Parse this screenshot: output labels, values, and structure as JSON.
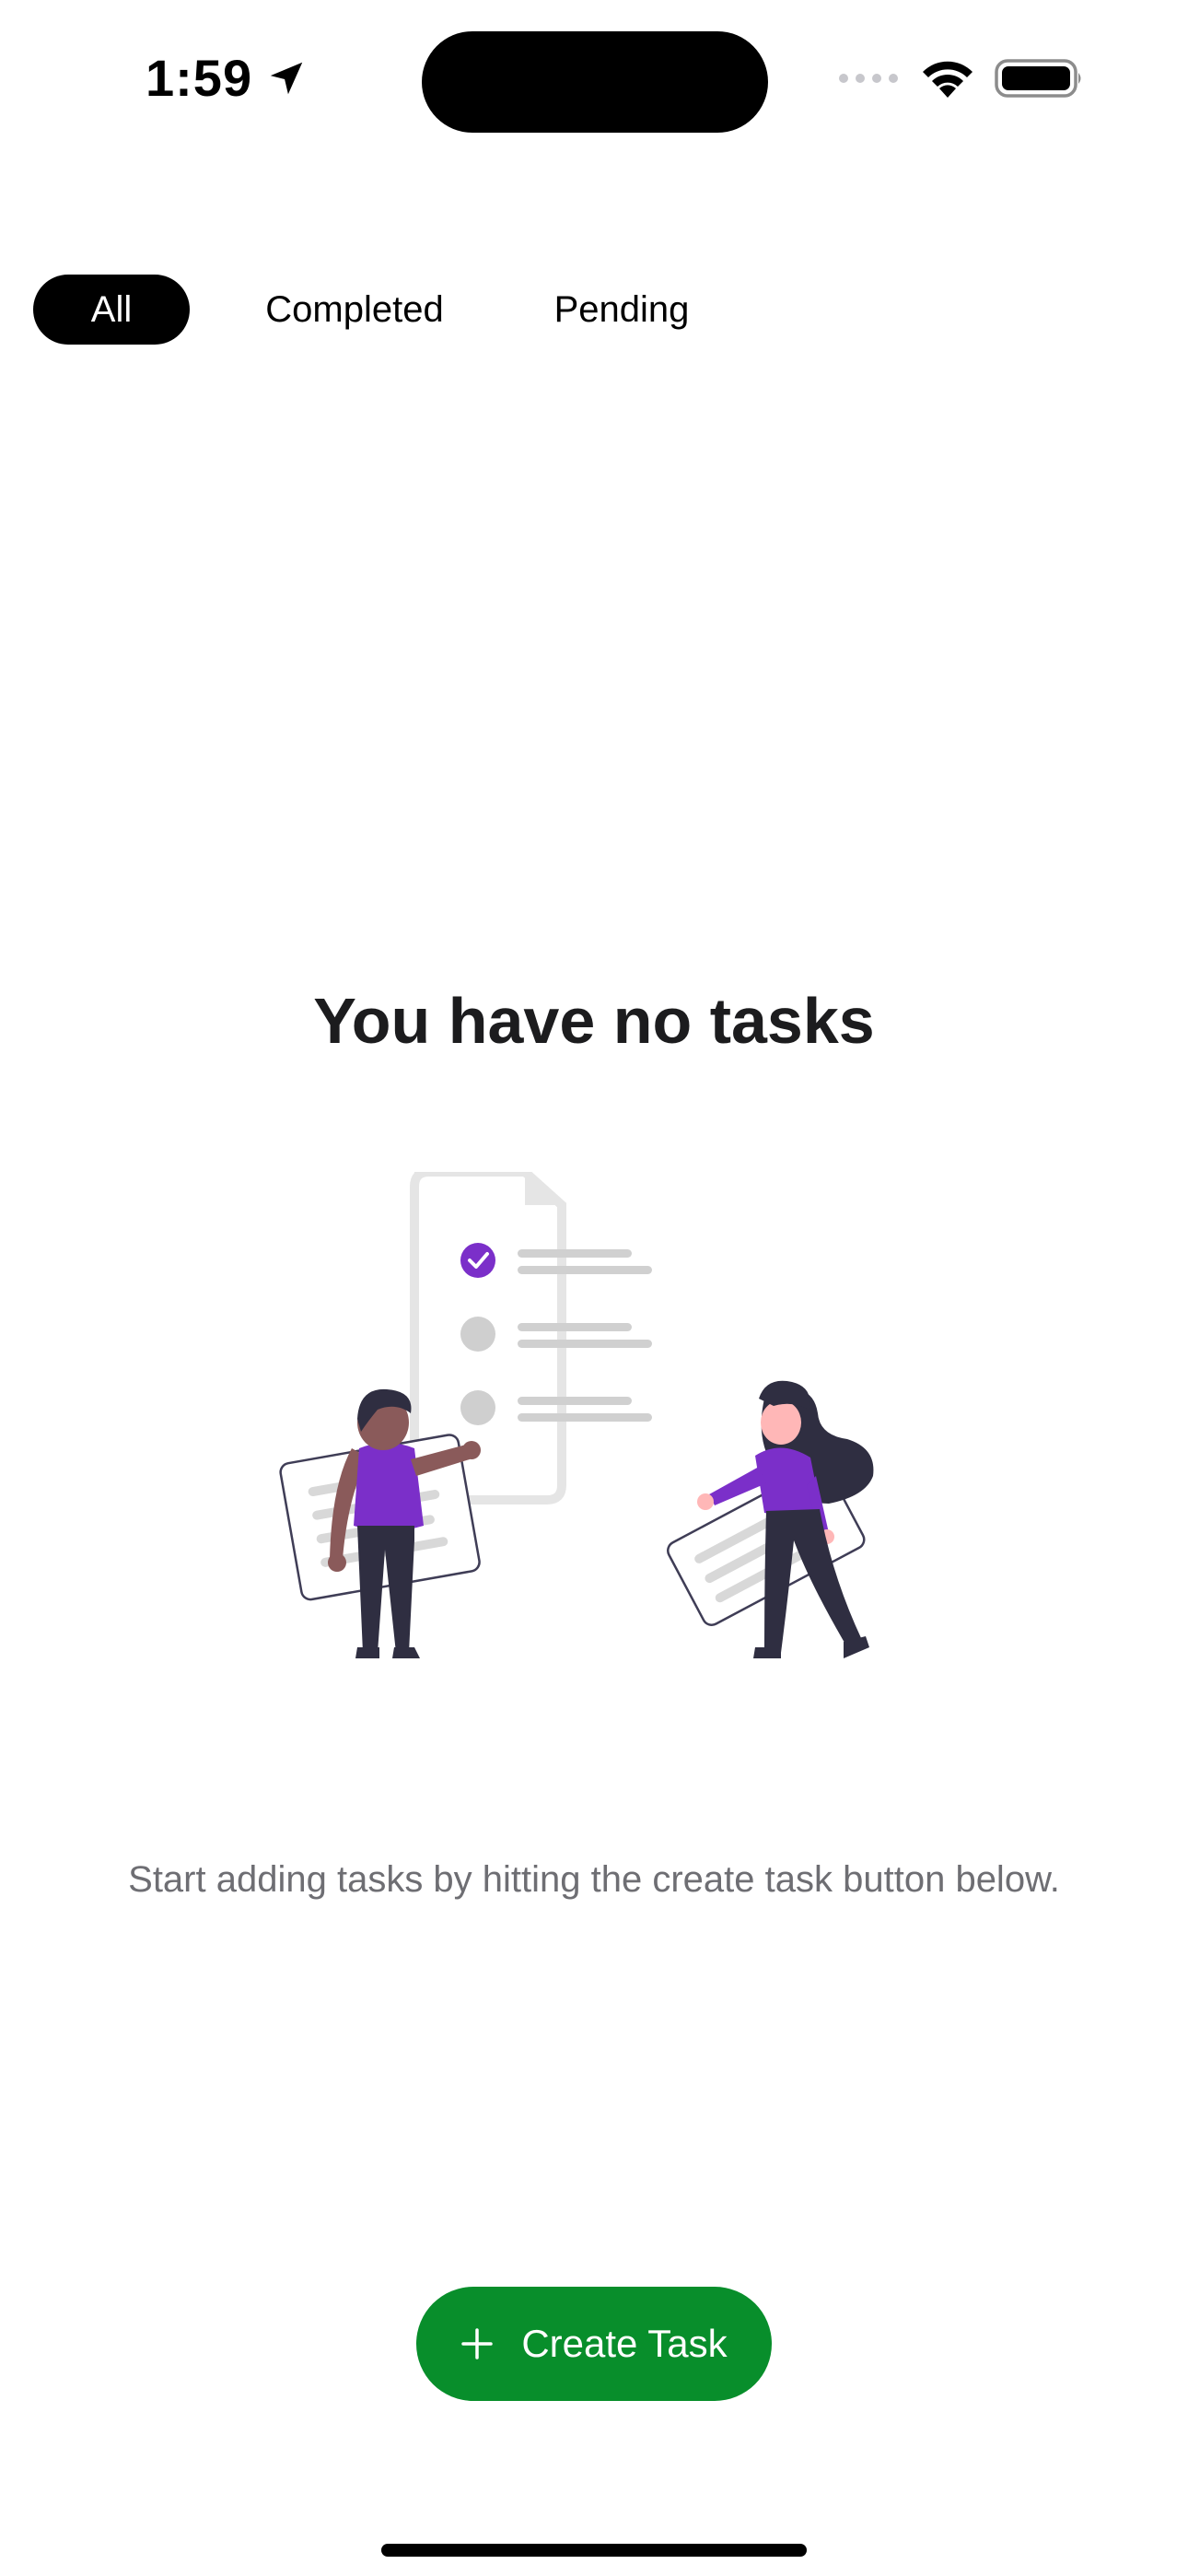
{
  "status_bar": {
    "time": "1:59",
    "icons": [
      "location-arrow-icon",
      "signal-icon",
      "wifi-icon",
      "battery-icon"
    ]
  },
  "filters": {
    "tabs": [
      {
        "label": "All",
        "active": true
      },
      {
        "label": "Completed",
        "active": false
      },
      {
        "label": "Pending",
        "active": false
      }
    ]
  },
  "empty_state": {
    "title": "You have no tasks",
    "subtitle": "Start adding tasks by hitting the create task button below.",
    "illustration": "people-with-checklist-illustration"
  },
  "create_button": {
    "label": "Create Task",
    "icon": "plus-icon"
  },
  "colors": {
    "accent_green": "#088e2b",
    "active_tab_bg": "#000000",
    "illustration_purple": "#7b2fc9",
    "subtitle_gray": "#6e6e73"
  }
}
